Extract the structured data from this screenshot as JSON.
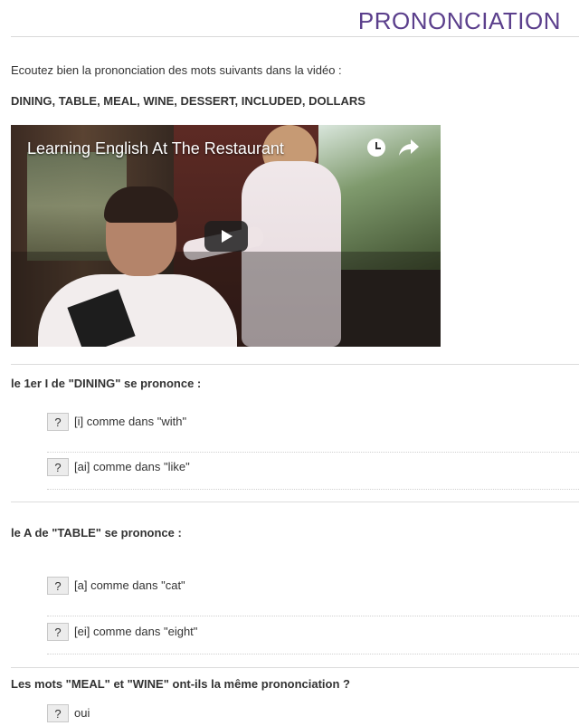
{
  "header": {
    "title": "PRONONCIATION"
  },
  "intro": {
    "instruction": "Ecoutez bien la prononciation des mots suivants dans la vidéo :",
    "words": "DINING, TABLE, MEAL, WINE, DESSERT, INCLUDED, DOLLARS"
  },
  "video": {
    "title": "Learning English At The Restaurant",
    "icons": [
      "clock-icon",
      "share-icon",
      "play-icon"
    ]
  },
  "questions": [
    {
      "text": "le 1er I de \"DINING\" se prononce :",
      "options": [
        {
          "button": "?",
          "label": "[i] comme dans \"with\""
        },
        {
          "button": "?",
          "label": "[ai] comme dans \"like\""
        }
      ]
    },
    {
      "text": "le A de \"TABLE\" se prononce :",
      "options": [
        {
          "button": "?",
          "label": "[a] comme dans \"cat\""
        },
        {
          "button": "?",
          "label": "[ei] comme dans \"eight\""
        }
      ]
    },
    {
      "text": "Les mots \"MEAL\" et \"WINE\" ont-ils la même prononciation ?",
      "options": [
        {
          "button": "?",
          "label": "oui"
        }
      ]
    }
  ],
  "colors": {
    "title": "#5b3f8c",
    "text": "#333333",
    "rule": "#d9d9d9"
  }
}
